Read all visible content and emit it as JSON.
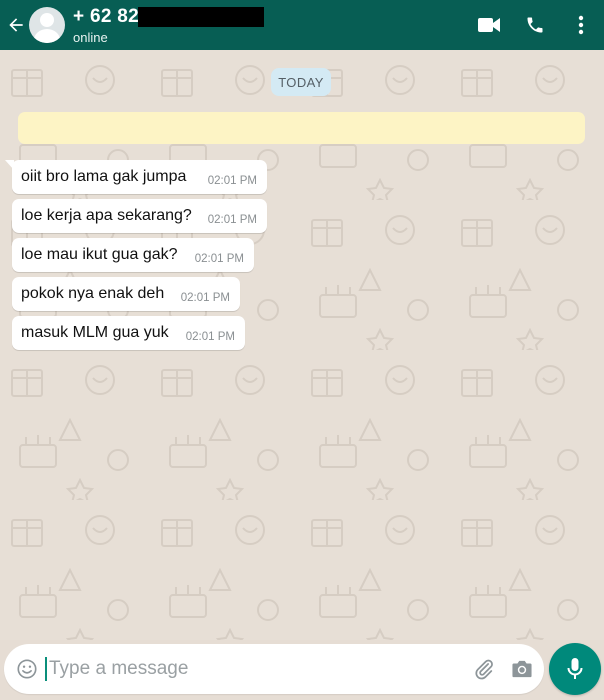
{
  "header": {
    "contact_name": "+ 62 82",
    "contact_status": "online",
    "icons": [
      "back-arrow-icon",
      "avatar-icon",
      "video-call-icon",
      "phone-icon",
      "more-vert-icon"
    ]
  },
  "chat": {
    "date_label": "TODAY",
    "messages": [
      {
        "text": "oiit bro lama gak jumpa",
        "time": "02:01 PM"
      },
      {
        "text": "loe kerja apa sekarang?",
        "time": "02:01 PM"
      },
      {
        "text": "loe mau ikut gua gak?",
        "time": "02:01 PM"
      },
      {
        "text": "pokok nya enak deh",
        "time": "02:01 PM"
      },
      {
        "text": "masuk MLM gua yuk",
        "time": "02:01 PM"
      }
    ]
  },
  "composer": {
    "placeholder": "Type a message",
    "icons": [
      "emoji-icon",
      "paperclip-icon",
      "camera-icon",
      "mic-icon"
    ]
  },
  "colors": {
    "header": "#075e54",
    "chat_background": "#e7dfd6",
    "bubble_incoming": "#ffffff",
    "date_pill": "#d4eaf4",
    "encryption_notice": "#fdf4c5",
    "mic_button": "#00897b"
  }
}
